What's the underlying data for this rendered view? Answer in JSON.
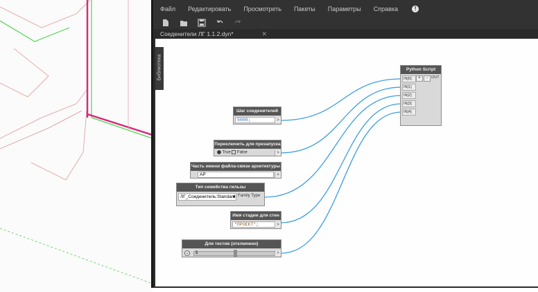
{
  "menu": {
    "file": "Файл",
    "edit": "Редактировать",
    "view": "Просмотреть",
    "packages": "Пакеты",
    "settings": "Параметры",
    "help": "Справка"
  },
  "tab": {
    "title": "Соеденители ЛГ 1.1.2.dyn*",
    "close": "✕"
  },
  "library": {
    "label": "Библиотека"
  },
  "nodes": {
    "step": {
      "title": "Шаг соеденителей",
      "value": "5000;",
      "out": ">"
    },
    "toggle": {
      "title": "Переключить для презапуска",
      "true_label": "True",
      "false_label": "False",
      "out": ">"
    },
    "arch_name": {
      "title": "Часть имени файла-связи архитектуры",
      "value": "АР",
      "out": ">"
    },
    "family_type": {
      "title": "Тип семейства гильзы",
      "value": "ЛГ_Соеденитель:Standard",
      "dropdown": "▾",
      "out_label": "Family Type"
    },
    "stage": {
      "title": "Имя стадии для стен",
      "value": "\"ПРОЕКТ\";",
      "out": ">"
    },
    "tests": {
      "title": "Для тестов (отключено)",
      "value": "5",
      "out": ">",
      "slider_level": 0.5
    },
    "python": {
      "title": "Python Script",
      "inputs": [
        "IN[0]",
        "IN[1]",
        "IN[2]",
        "IN[3]",
        "IN[4]"
      ],
      "plus": "+",
      "minus": "-",
      "out": "OUT"
    }
  },
  "colors": {
    "wire": "#3a9de0",
    "dark_bg": "#323232",
    "node_title": "#555555"
  }
}
